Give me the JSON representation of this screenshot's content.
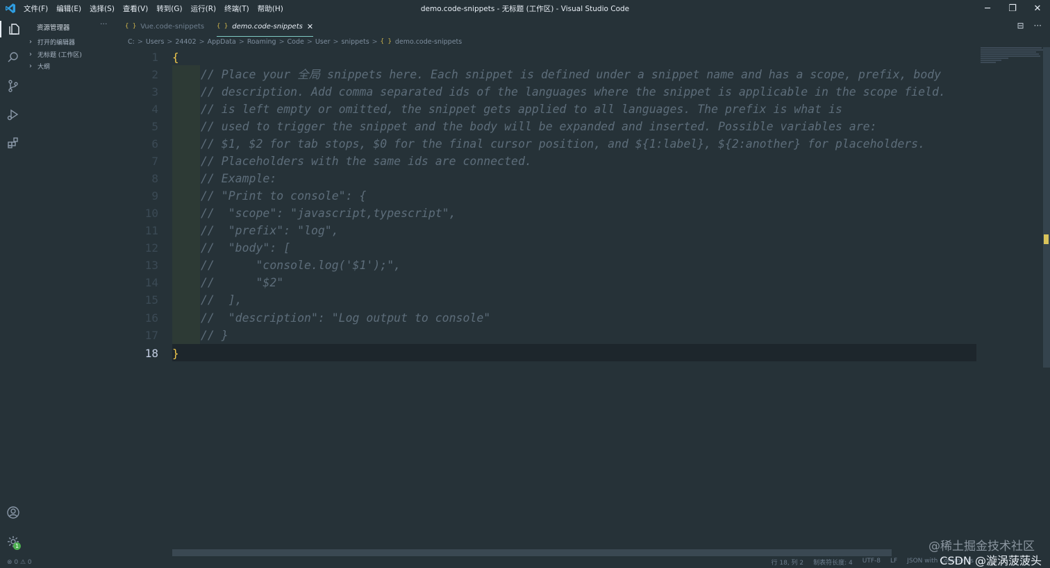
{
  "titlebar": {
    "window_title": "demo.code-snippets - 无标题 (工作区) - Visual Studio Code",
    "menu": [
      "文件(F)",
      "编辑(E)",
      "选择(S)",
      "查看(V)",
      "转到(G)",
      "运行(R)",
      "终端(T)",
      "帮助(H)"
    ],
    "controls": {
      "minimize": "─",
      "restore": "❐",
      "close": "✕"
    }
  },
  "sidebar": {
    "title": "资源管理器",
    "more": "···",
    "sections": [
      "打开的编辑器",
      "无标题 (工作区)",
      "大纲"
    ]
  },
  "tabs": [
    {
      "icon": "{ }",
      "label": "Vue.code-snippets",
      "active": false
    },
    {
      "icon": "{ }",
      "label": "demo.code-snippets",
      "active": true,
      "close": "✕"
    }
  ],
  "editor_actions": {
    "split": "⊟",
    "more": "···"
  },
  "breadcrumb": {
    "items": [
      "C:",
      "Users",
      "24402",
      "AppData",
      "Roaming",
      "Code",
      "User",
      "snippets"
    ],
    "file_icon": "{ }",
    "file": "demo.code-snippets",
    "separator": ">"
  },
  "code_lines": [
    {
      "n": "1",
      "text": "{"
    },
    {
      "n": "2",
      "text": "// Place your 全局 snippets here. Each snippet is defined under a snippet name and has a scope, prefix, body"
    },
    {
      "n": "3",
      "text": "// description. Add comma separated ids of the languages where the snippet is applicable in the scope field."
    },
    {
      "n": "4",
      "text": "// is left empty or omitted, the snippet gets applied to all languages. The prefix is what is"
    },
    {
      "n": "5",
      "text": "// used to trigger the snippet and the body will be expanded and inserted. Possible variables are:"
    },
    {
      "n": "6",
      "text": "// $1, $2 for tab stops, $0 for the final cursor position, and ${1:label}, ${2:another} for placeholders."
    },
    {
      "n": "7",
      "text": "// Placeholders with the same ids are connected."
    },
    {
      "n": "8",
      "text": "// Example:"
    },
    {
      "n": "9",
      "text": "// \"Print to console\": {"
    },
    {
      "n": "10",
      "text": "//  \"scope\": \"javascript,typescript\","
    },
    {
      "n": "11",
      "text": "//  \"prefix\": \"log\","
    },
    {
      "n": "12",
      "text": "//  \"body\": ["
    },
    {
      "n": "13",
      "text": "//      \"console.log('$1');\","
    },
    {
      "n": "14",
      "text": "//      \"$2\""
    },
    {
      "n": "15",
      "text": "//  ],"
    },
    {
      "n": "16",
      "text": "//  \"description\": \"Log output to console\""
    },
    {
      "n": "17",
      "text": "// }"
    },
    {
      "n": "18",
      "text": "}"
    }
  ],
  "statusbar": {
    "errors": "⊗ 0 ⚠ 0",
    "position": "行 18, 列 2",
    "tab_size": "制表符长度: 4",
    "encoding": "UTF-8",
    "eol": "LF",
    "language": "JSON with Comments"
  },
  "activity_badge": "1",
  "watermark": {
    "line1": "@稀土掘金技术社区",
    "line2": "CSDN @漩涡菠菠头"
  },
  "colors": {
    "background": "#263238",
    "brace": "#f2c94c",
    "comment": "#5d6d7a",
    "accent": "#80cbc4"
  }
}
